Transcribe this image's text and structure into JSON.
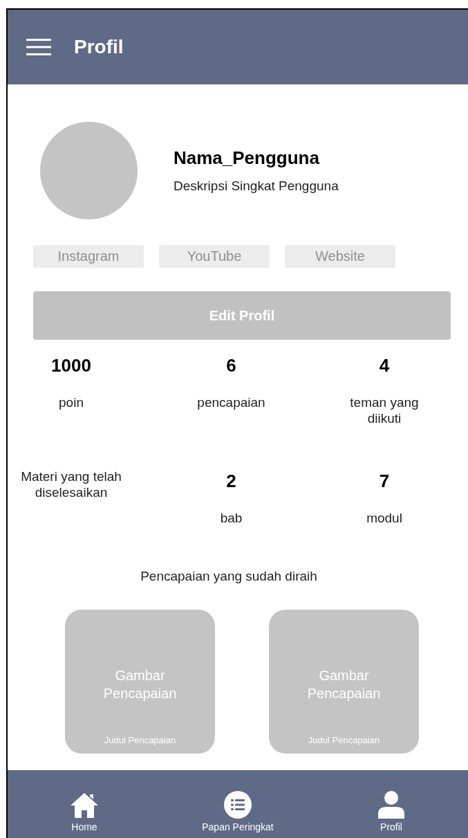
{
  "header": {
    "title": "Profil"
  },
  "profile": {
    "name": "Nama_Pengguna",
    "description": "Deskripsi Singkat Pengguna"
  },
  "links": [
    "Instagram",
    "YouTube",
    "Website"
  ],
  "edit_button": "Edit Profil",
  "stats": [
    {
      "kind": "stat",
      "value": "1000",
      "label": "poin"
    },
    {
      "kind": "stat",
      "value": "6",
      "label": "pencapaian"
    },
    {
      "kind": "stat",
      "value": "4",
      "label": "teman yang diikuti"
    }
  ],
  "completed": {
    "caption": "Materi yang telah diselesaikan",
    "stats": [
      {
        "value": "2",
        "unit": "bab"
      },
      {
        "value": "7",
        "unit": "modul"
      }
    ]
  },
  "achievements": {
    "heading": "Pencapaian yang sudah diraih",
    "items": [
      {
        "image_label": "Gambar Pencapaian",
        "title": "Judul Pencapaian"
      },
      {
        "image_label": "Gambar Pencapaian",
        "title": "Judul Pencapaian"
      }
    ]
  },
  "bottom_nav": [
    {
      "kind": "home",
      "label": "Home"
    },
    {
      "kind": "list",
      "label": "Papan Peringkat"
    },
    {
      "kind": "person",
      "label": "Profil"
    }
  ]
}
